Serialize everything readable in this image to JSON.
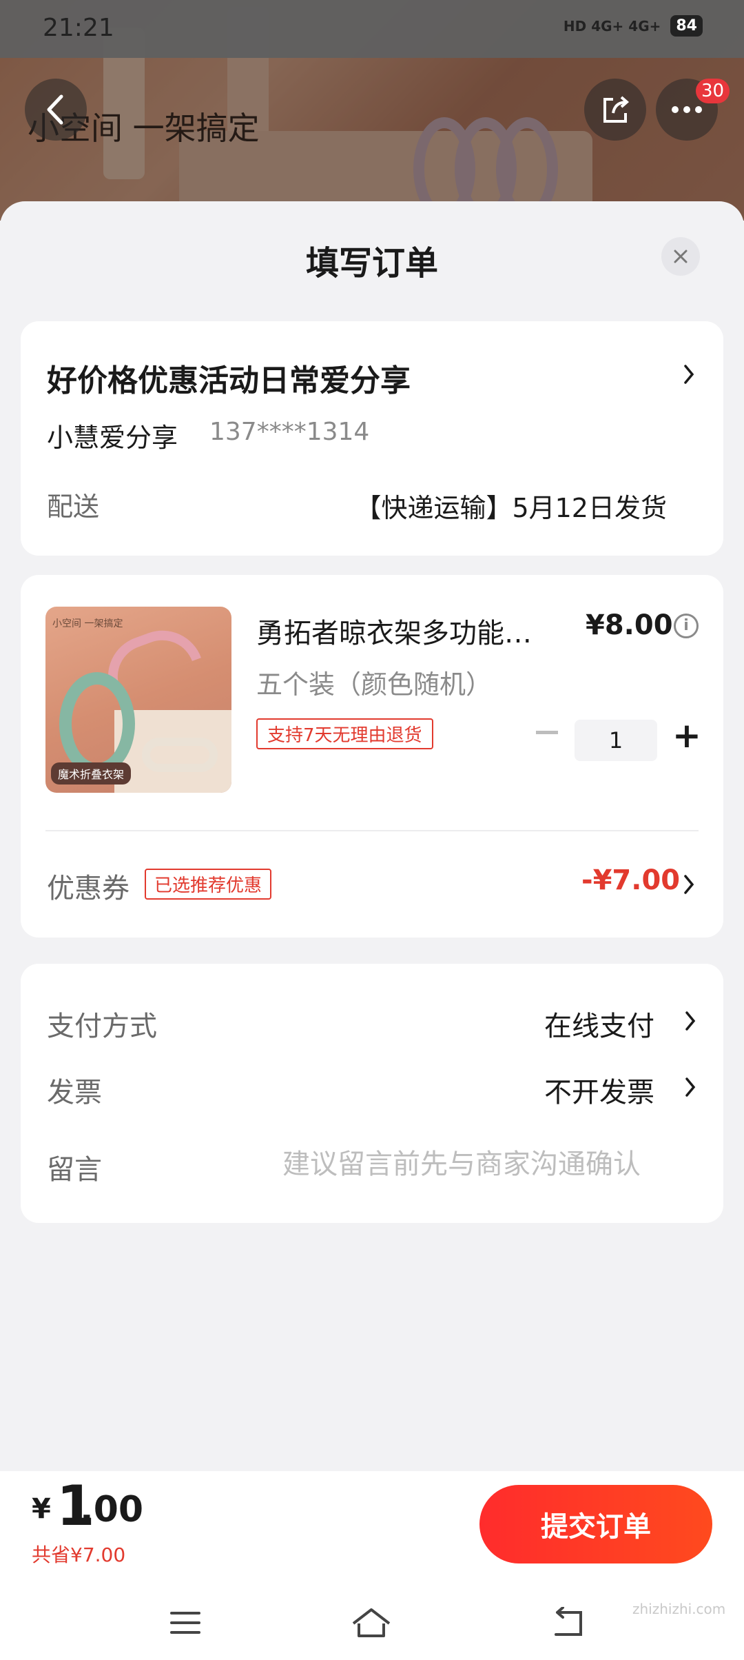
{
  "status_bar": {
    "time": "21:21",
    "network": "HD 4G+ 4G+",
    "battery": "84"
  },
  "background_page": {
    "headline": "小空间 一架搞定",
    "message_badge": "30"
  },
  "sheet": {
    "title": "填写订单",
    "address": {
      "title": "好价格优惠活动日常爱分享",
      "name": "小慧爱分享",
      "phone": "137****1314",
      "delivery_label": "配送",
      "delivery_value": "【快递运输】5月12日发货"
    },
    "product": {
      "name": "勇拓者晾衣架多功能…",
      "price": "¥8.00",
      "spec": "五个装（颜色随机）",
      "return_policy": "支持7天无理由退货",
      "quantity": "1",
      "thumb_top_text": "小空间 一架搞定",
      "thumb_tag": "魔术折叠衣架"
    },
    "coupon": {
      "label": "优惠券",
      "badge": "已选推荐优惠",
      "value": "-¥7.00"
    },
    "payment": {
      "pay_label": "支付方式",
      "pay_value": "在线支付",
      "invoice_label": "发票",
      "invoice_value": "不开发票",
      "memo_label": "留言",
      "memo_placeholder": "建议留言前先与商家沟通确认"
    }
  },
  "bottom_bar": {
    "currency": "¥",
    "total_int": "1",
    "total_dec": ".00",
    "saved": "共省¥7.00",
    "submit_label": "提交订单"
  },
  "watermark": "zhizhizhi.com",
  "colors": {
    "accent": "#e23a2e",
    "submit_start": "#ff2c2c",
    "submit_end": "#ff4a1e"
  }
}
